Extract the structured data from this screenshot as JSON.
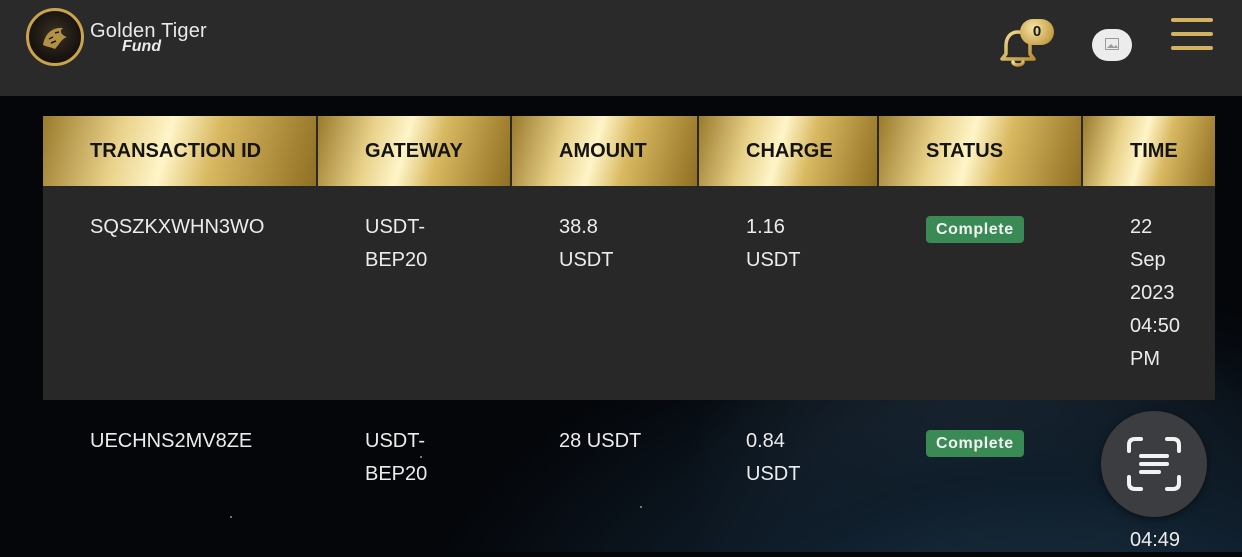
{
  "header": {
    "brand_line1": "Golden Tiger",
    "brand_line2": "Fund",
    "notification_count": "0",
    "accent_color": "#c9a44a"
  },
  "table": {
    "columns": [
      "TRANSACTION ID",
      "GATEWAY",
      "AMOUNT",
      "CHARGE",
      "STATUS",
      "TIME"
    ],
    "rows": [
      {
        "transaction_id": "SQSZKXWHN3WO",
        "gateway": "USDT-\nBEP20",
        "amount": "38.8\nUSDT",
        "charge": "1.16\nUSDT",
        "status": "Complete",
        "time": "22\nSep\n2023\n04:50\nPM"
      },
      {
        "transaction_id": "UECHNS2MV8ZE",
        "gateway": "USDT-\nBEP20",
        "amount": "28 USDT",
        "charge": "0.84\nUSDT",
        "status": "Complete",
        "time": "04:49"
      }
    ],
    "status_color": "#3a8a55"
  },
  "icons": {
    "logo": "tiger-logo-icon",
    "bell": "bell-icon",
    "avatar": "image-placeholder-icon",
    "menu": "hamburger-menu-icon",
    "scan": "scan-text-icon"
  }
}
